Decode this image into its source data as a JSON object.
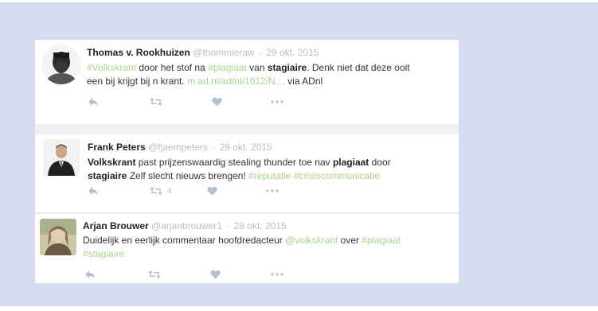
{
  "tweets": [
    {
      "name": "Thomas v. Rookhuizen",
      "handle": "@thommieraw",
      "date": "29 okt. 2015",
      "line1": {
        "tag1": "#Volkskrant",
        "t1": " door het stof na ",
        "tag2": "#plagiaat",
        "t2": " van ",
        "bold1": "stagiaire",
        "t3": ". Denk niet dat deze ooit"
      },
      "line2": {
        "t1": "een bij krijgt bij n krant. ",
        "link": "m.ad.nl/ad/nl/1012/N…",
        "t2": " via ADnl"
      },
      "retweet_count": ""
    },
    {
      "name": "Frank Peters",
      "handle": "@fjaempeters",
      "date": "29 okt. 2015",
      "line1": {
        "bold1": "Volkskrant",
        "t1": " past prijzenswaardig stealing thunder toe nav ",
        "bold2": "plagiaat",
        "t2": " door"
      },
      "line2": {
        "bold1": "stagiaire",
        "t1": " Zelf slecht nieuws brengen! ",
        "tag1": "#reputatie",
        "t2": " ",
        "tag2": "#crisiscommunicatie"
      },
      "retweet_count": "4"
    },
    {
      "name": "Arjan Brouwer",
      "handle": "@arjanbrouwer1",
      "date": "28 okt. 2015",
      "line1": {
        "t1": "Duidelijk en eerlijk commentaar hoofdredacteur ",
        "tag1": "@volkskrant",
        "t2": " over ",
        "tag2": "#plagiaat"
      },
      "line2": {
        "tag1": "#stagiaire"
      },
      "retweet_count": ""
    }
  ],
  "dot": "·",
  "colors": {
    "background": "#d5dcee",
    "hashtag": "#a9d38f",
    "muted": "#b8bec6",
    "icon": "#b3c0cf"
  }
}
